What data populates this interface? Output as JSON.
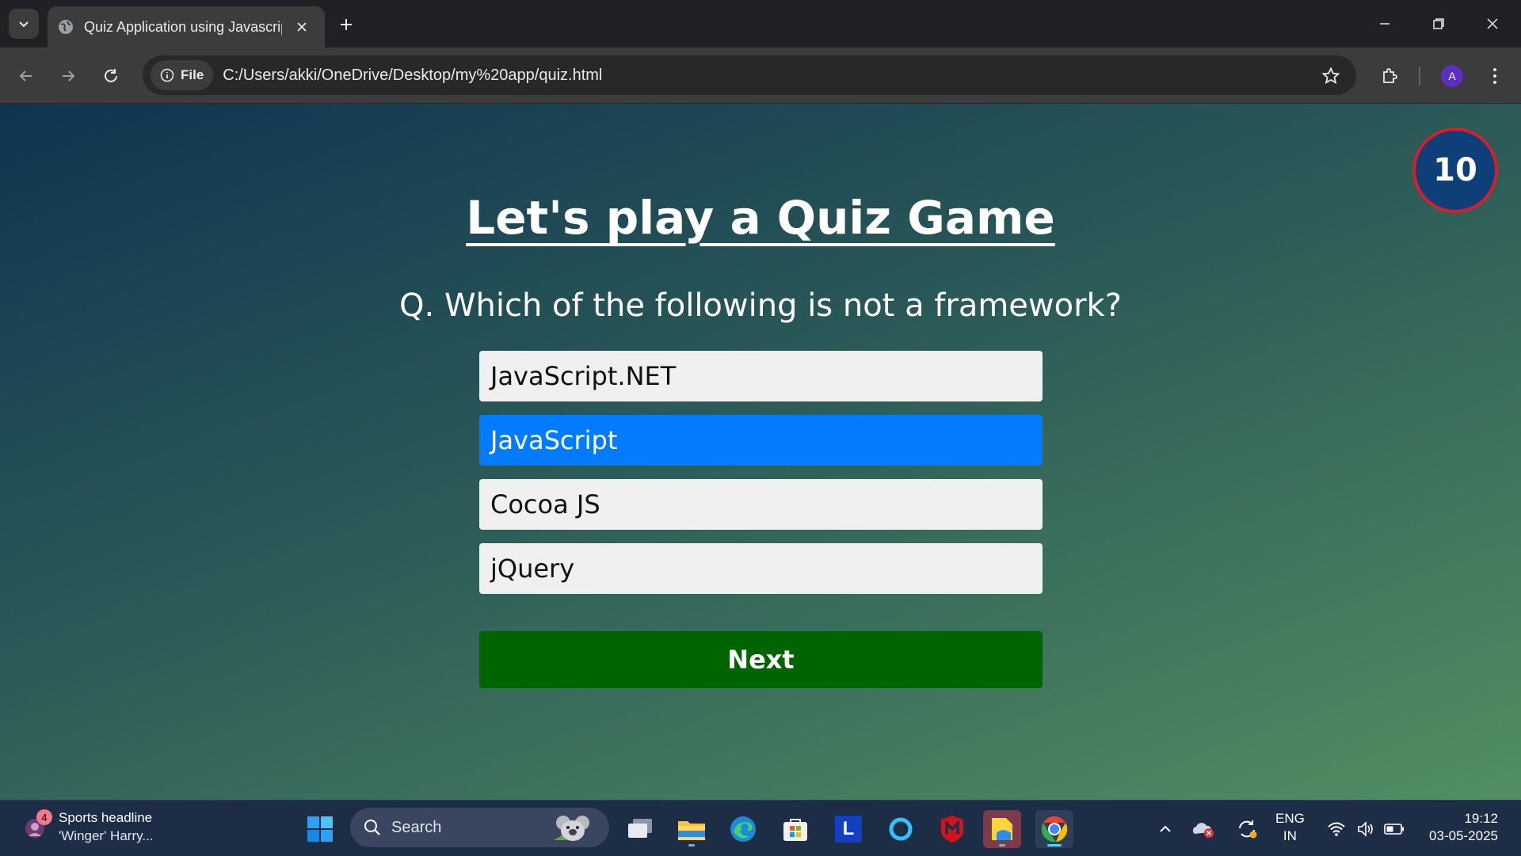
{
  "browser": {
    "tab_title": "Quiz Application using Javascript",
    "site_chip_label": "File",
    "url": "C:/Users/akki/OneDrive/Desktop/my%20app/quiz.html",
    "profile_initial": "A"
  },
  "quiz": {
    "timer": "10",
    "title": "Let's play a Quiz Game",
    "question": "Q. Which of the following is not a framework?",
    "options": [
      "JavaScript.NET",
      "JavaScript",
      "Cocoa JS",
      "jQuery"
    ],
    "selected_option": "JavaScript",
    "next_label": "Next",
    "colors": {
      "selected": "#027bff",
      "next": "#006400",
      "timer_border": "#d3202a",
      "timer_bg": "#0e3f78"
    }
  },
  "taskbar": {
    "news_badge": "4",
    "news_title": "Sports headline",
    "news_sub": "'Winger' Harry...",
    "search_label": "Search",
    "lang_line1": "ENG",
    "lang_line2": "IN",
    "time": "19:12",
    "date": "03-05-2025",
    "app_letter": "L"
  }
}
